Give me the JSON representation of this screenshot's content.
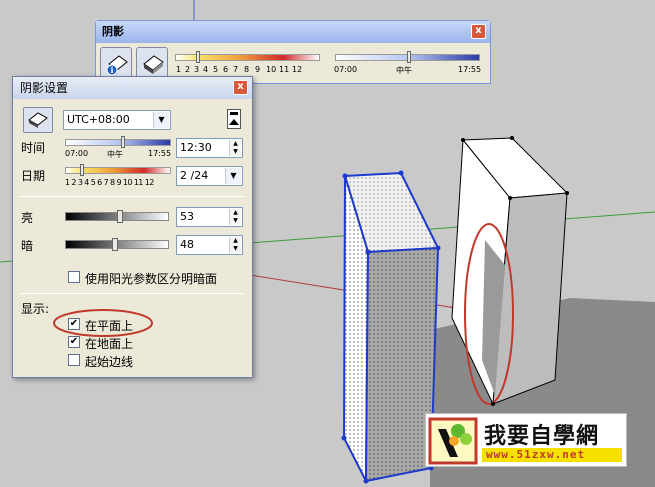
{
  "toolbar": {
    "title": "阴影",
    "close": "x",
    "month_ticks": [
      "1",
      "2",
      "3",
      "4",
      "5",
      "6",
      "7",
      "8",
      "9",
      "10",
      "11",
      "12"
    ],
    "month_value": 3,
    "time_start": "07:00",
    "time_noon": "中午",
    "time_end": "17:55",
    "time_value": "12:30"
  },
  "dialog": {
    "title": "阴影设置",
    "close": "x",
    "timezone": "UTC+08:00",
    "time": {
      "label": "时间",
      "start": "07:00",
      "noon": "中午",
      "end": "17:55",
      "value": "12:30",
      "fraction": 0.56
    },
    "date": {
      "label": "日期",
      "ticks": "1 2 3 4 5 6 7 8 9 10 11 12",
      "value": "2 /24",
      "fraction": 0.14
    },
    "light": {
      "label": "亮",
      "value": "53",
      "fraction": 0.53
    },
    "dark": {
      "label": "暗",
      "value": "48",
      "fraction": 0.48
    },
    "sun_option": {
      "label": "使用阳光参数区分明暗面",
      "checked": false
    },
    "display_label": "显示:",
    "on_faces": {
      "label": "在平面上",
      "checked": true,
      "mark": "✔"
    },
    "on_ground": {
      "label": "在地面上",
      "checked": true,
      "mark": "✔"
    },
    "from_edges": {
      "label": "起始边线",
      "checked": false,
      "mark": ""
    }
  },
  "watermark": {
    "title": "我要自學網",
    "url": "www.51zxw.net"
  },
  "colors": {
    "window_bg": "#ece9d8",
    "title_blue": "#9ab4ea",
    "highlight_red": "#c0392b",
    "watermark_red": "#c0392b",
    "watermark_yellow": "#f5e000"
  }
}
